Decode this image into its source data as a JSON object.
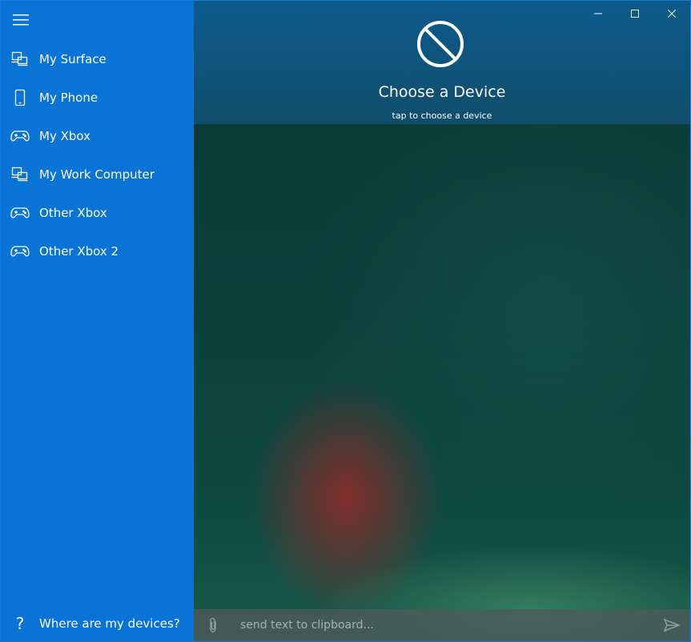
{
  "sidebar": {
    "menu_icon": "hamburger-icon",
    "items": [
      {
        "label": "My Surface",
        "icon": "laptop-icon"
      },
      {
        "label": "My Phone",
        "icon": "phone-icon"
      },
      {
        "label": "My Xbox",
        "icon": "gamepad-icon"
      },
      {
        "label": "My Work Computer",
        "icon": "laptop-icon"
      },
      {
        "label": "Other Xbox",
        "icon": "gamepad-icon"
      },
      {
        "label": "Other Xbox 2",
        "icon": "gamepad-icon"
      }
    ],
    "help": {
      "label": "Where are my devices?",
      "icon": "question-icon"
    }
  },
  "header": {
    "title": "Choose a Device",
    "subtitle": "tap to choose a device",
    "icon": "no-device-icon"
  },
  "input_bar": {
    "placeholder": "send text to clipboard...",
    "value": ""
  },
  "colors": {
    "sidebar": "#0a73d6",
    "header": "#0f5378",
    "accent_border": "#1979d6"
  }
}
